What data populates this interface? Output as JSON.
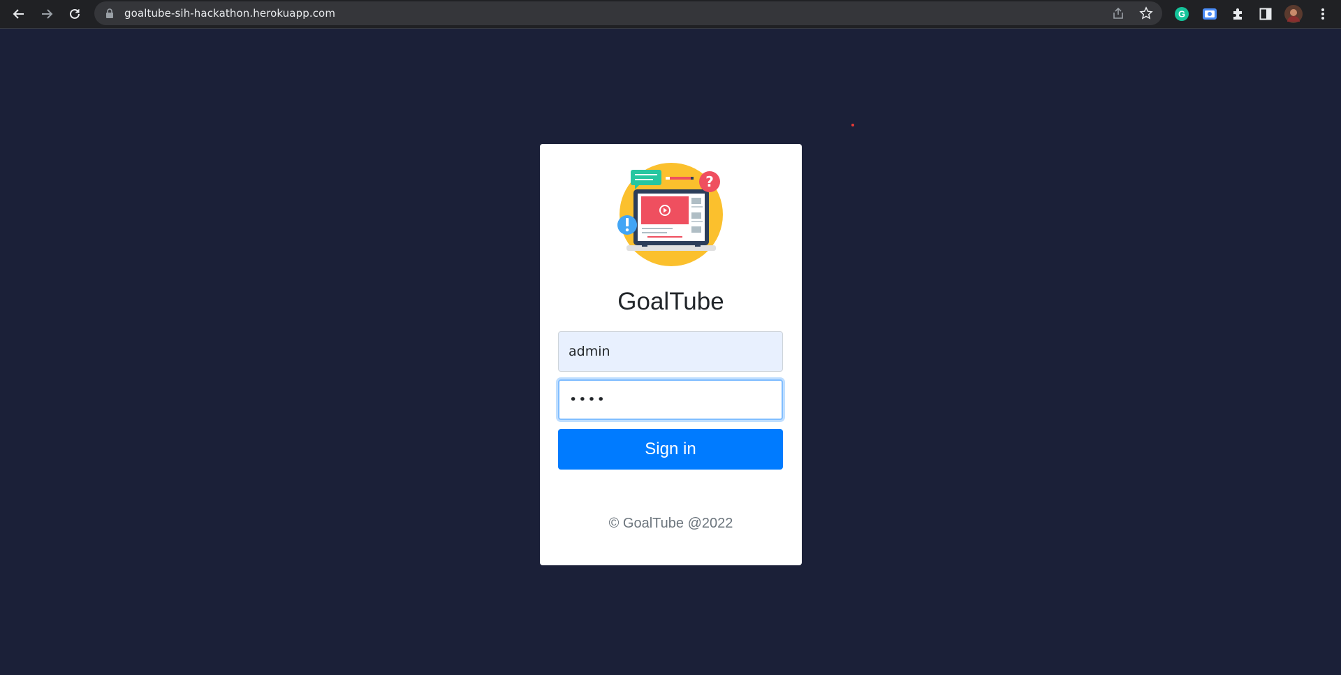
{
  "browser": {
    "url": "goaltube-sih-hackathon.herokuapp.com",
    "icons": [
      "back-arrow-icon",
      "forward-arrow-icon",
      "reload-icon",
      "lock-icon",
      "share-icon",
      "bookmark-star-icon",
      "grammarly-icon",
      "screen-capture-icon",
      "puzzle-extensions-icon",
      "side-panel-icon",
      "profile-avatar",
      "kebab-menu-icon"
    ]
  },
  "login": {
    "app_name": "GoalTube",
    "username_value": "admin",
    "password_value": "••••",
    "signin_label": "Sign in",
    "footer_text": "© GoalTube @2022"
  },
  "colors": {
    "page_background": "#1b2038",
    "primary_button": "#007bff",
    "username_autofill_background": "#e8f0fe"
  }
}
